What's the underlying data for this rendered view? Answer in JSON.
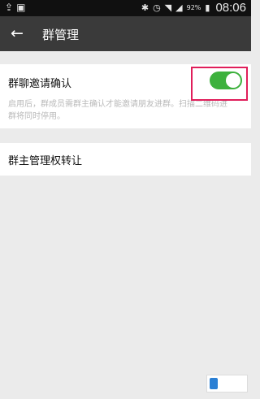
{
  "status_bar": {
    "left_icons": [
      "upload-icon",
      "image-icon"
    ],
    "right_icons": [
      "bluetooth-icon",
      "alarm-icon",
      "wifi-icon",
      "signal-icon"
    ],
    "battery": "92%",
    "time": "08:06"
  },
  "header": {
    "back_icon": "arrow-left-icon",
    "title": "群管理"
  },
  "settings": {
    "invite_confirm": {
      "title": "群聊邀请确认",
      "enabled": true,
      "description": "启用后，群成员需群主确认才能邀请朋友进群。扫描二维码进群将同时停用。"
    },
    "transfer_owner": {
      "title": "群主管理权转让"
    }
  },
  "colors": {
    "status_bar": "#101010",
    "app_bar": "#3a3a3a",
    "toggle_on": "#3db13d",
    "highlight": "#e01e5a",
    "background": "#ebebeb"
  },
  "watermark": {
    "text": "TSG手游网"
  }
}
